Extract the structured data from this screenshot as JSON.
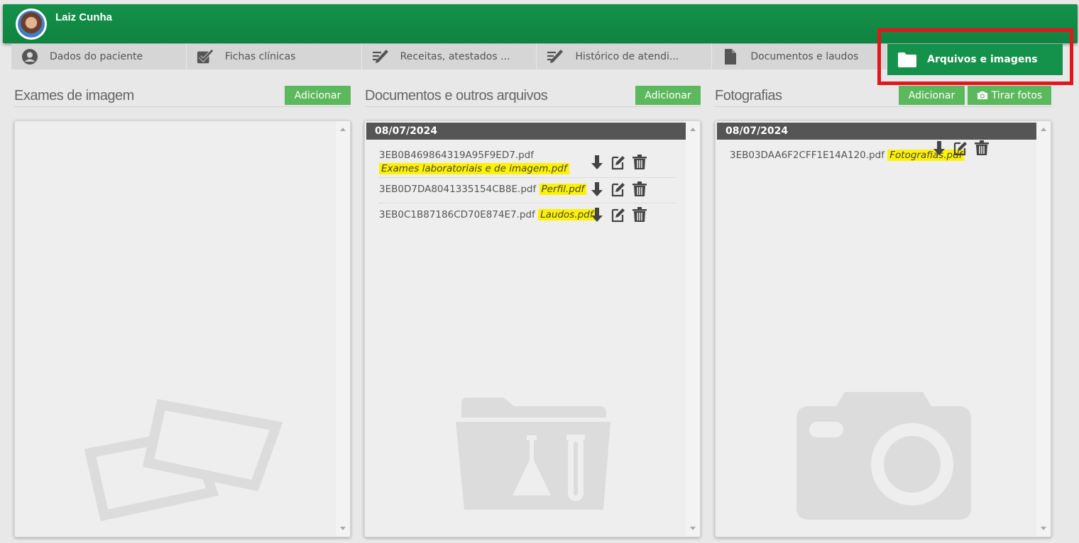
{
  "header": {
    "user_name": "Laiz Cunha"
  },
  "tabs": [
    {
      "label": "Dados do paciente",
      "icon": "user-icon"
    },
    {
      "label": "Fichas clínicas",
      "icon": "checklist-icon"
    },
    {
      "label": "Receitas, atestados ...",
      "icon": "pen-icon"
    },
    {
      "label": "Histórico de atendi...",
      "icon": "pen-icon"
    },
    {
      "label": "Documentos e laudos",
      "icon": "document-icon"
    },
    {
      "label": "Arquivos e imagens",
      "icon": "folder-icon",
      "active": true
    }
  ],
  "sections": {
    "exames": {
      "title": "Exames de imagem",
      "add_label": "Adicionar"
    },
    "documentos": {
      "title": "Documentos e outros arquivos",
      "add_label": "Adicionar",
      "date": "08/07/2024",
      "files": [
        {
          "name": "3EB0B469864319A95F9ED7.pdf",
          "tag": "Exames laboratoriais e de imagem.pdf"
        },
        {
          "name": "3EB0D7DA8041335154CB8E.pdf",
          "tag": "Perfil.pdf"
        },
        {
          "name": "3EB0C1B87186CD70E874E7.pdf",
          "tag": "Laudos.pdf"
        }
      ]
    },
    "fotografias": {
      "title": "Fotografias",
      "add_label": "Adicionar",
      "photo_label": "Tirar fotos",
      "date": "08/07/2024",
      "files": [
        {
          "name": "3EB03DAA6F2CFF1E14A120.pdf",
          "tag": "Fotografias.pdf"
        }
      ]
    }
  },
  "colors": {
    "header_green": "#14914a",
    "button_green": "#5cb85c",
    "highlight_red": "#e3161b",
    "tag_yellow": "#fff200"
  }
}
